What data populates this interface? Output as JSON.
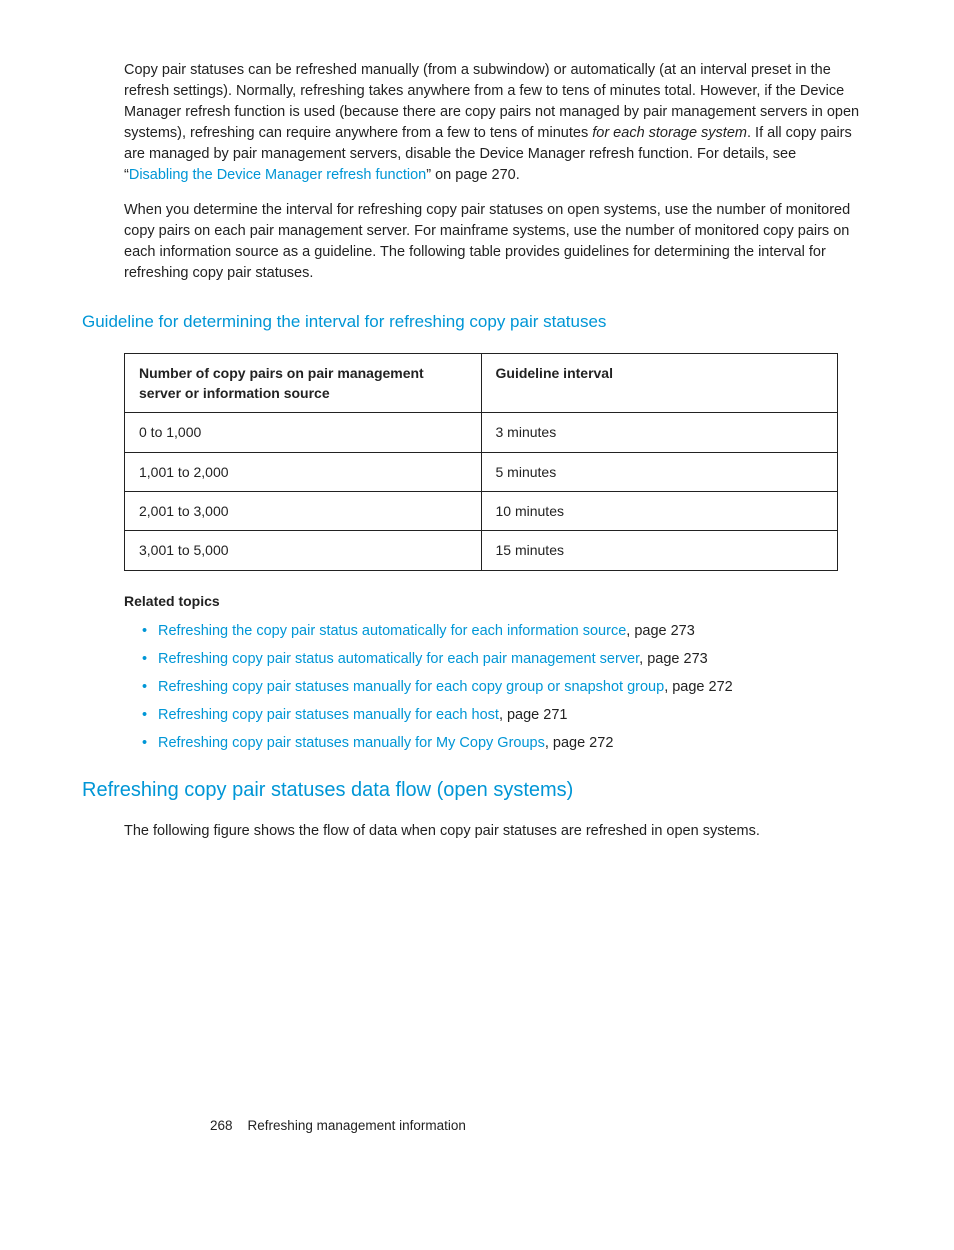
{
  "para1": {
    "t1": "Copy pair statuses can be refreshed manually (from a subwindow) or automatically (at an interval preset in the refresh settings). Normally, refreshing takes anywhere from a few to tens of minutes total. However, if the Device Manager refresh function is used (because there are copy pairs not managed by pair management servers in open systems), refreshing can require anywhere from a few to tens of minutes ",
    "italic": "for each storage system",
    "t2": ". If all copy pairs are managed by pair management servers, disable the Device Manager refresh function. For details, see “",
    "link": "Disabling the Device Manager refresh function",
    "t3": "” on page 270."
  },
  "para2": "When you determine the interval for refreshing copy pair statuses on open systems, use the number of monitored copy pairs on each pair management server. For mainframe systems, use the number of monitored copy pairs on each information source as a guideline. The following table provides guidelines for determining the interval for refreshing copy pair statuses.",
  "h3_guideline": "Guideline for determining the interval for refreshing copy pair statuses",
  "table": {
    "headers": [
      "Number of copy pairs on pair management server or information source",
      "Guideline interval"
    ],
    "rows": [
      [
        "0 to 1,000",
        "3 minutes"
      ],
      [
        "1,001 to 2,000",
        "5 minutes"
      ],
      [
        "2,001 to 3,000",
        "10 minutes"
      ],
      [
        "3,001 to 5,000",
        "15 minutes"
      ]
    ]
  },
  "related_heading": "Related topics",
  "related": [
    {
      "link": "Refreshing the copy pair status automatically for each information source",
      "suffix": ", page 273"
    },
    {
      "link": "Refreshing copy pair status automatically for each pair management server",
      "suffix": ", page 273"
    },
    {
      "link": "Refreshing copy pair statuses manually for each copy group or snapshot group",
      "suffix": ", page 272"
    },
    {
      "link": "Refreshing copy pair statuses manually for each host",
      "suffix": ", page 271"
    },
    {
      "link": "Refreshing copy pair statuses manually for My Copy Groups",
      "suffix": ", page 272"
    }
  ],
  "h2_flow": "Refreshing copy pair statuses data flow (open systems)",
  "para3": "The following figure shows the flow of data when copy pair statuses are refreshed in open systems.",
  "footer": {
    "page": "268",
    "title": "Refreshing management information"
  }
}
